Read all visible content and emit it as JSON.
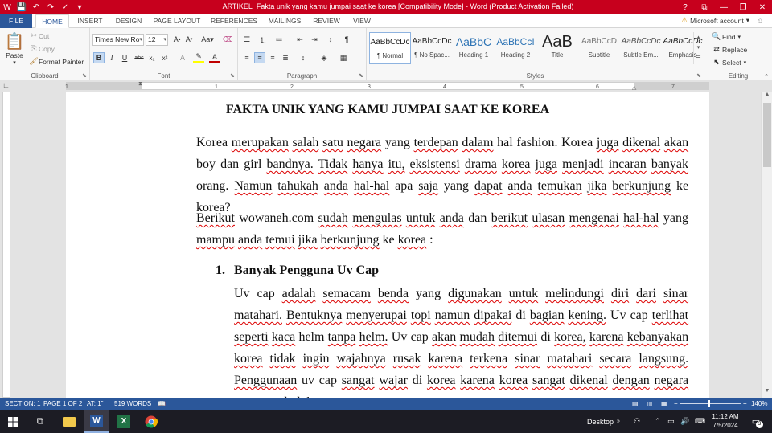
{
  "window": {
    "title": "ARTIKEL_Fakta unik yang kamu jumpai saat ke korea [Compatibility Mode] - Word (Product Activation Failed)",
    "controls": {
      "help": "?",
      "ribbon_opts": "⧉",
      "minimize": "—",
      "restore": "❐",
      "close": "✕"
    }
  },
  "qat": {
    "save_icon": "save-icon",
    "undo_icon": "undo-icon",
    "redo_icon": "redo-icon",
    "spell_icon": "spell-check-icon",
    "customize_icon": "customize-icon"
  },
  "ribbon_tabs": [
    "FILE",
    "HOME",
    "INSERT",
    "DESIGN",
    "PAGE LAYOUT",
    "REFERENCES",
    "MAILINGS",
    "REVIEW",
    "VIEW"
  ],
  "active_tab": "HOME",
  "account": {
    "warning": "⚠",
    "label": "Microsoft account",
    "caret": "▾"
  },
  "clipboard": {
    "paste": "Paste",
    "cut": "Cut",
    "copy": "Copy",
    "format_painter": "Format Painter",
    "group_label": "Clipboard"
  },
  "font": {
    "name": "Times New Ro",
    "size": "12",
    "group_label": "Font"
  },
  "paragraph": {
    "group_label": "Paragraph"
  },
  "styles": {
    "group_label": "Styles",
    "items": [
      {
        "preview": "AaBbCcDc",
        "label": "¶ Normal"
      },
      {
        "preview": "AaBbCcDc",
        "label": "¶ No Spac..."
      },
      {
        "preview": "AaBbC",
        "label": "Heading 1"
      },
      {
        "preview": "AaBbCcI",
        "label": "Heading 2"
      },
      {
        "preview": "AaB",
        "label": "Title"
      },
      {
        "preview": "AaBbCcD",
        "label": "Subtitle"
      },
      {
        "preview": "AaBbCcDc",
        "label": "Subtle Em..."
      },
      {
        "preview": "AaBbCcDc",
        "label": "Emphasis"
      }
    ]
  },
  "editing": {
    "find": "Find",
    "replace": "Replace",
    "select": "Select",
    "group_label": "Editing"
  },
  "ruler_numbers": [
    "1",
    "1",
    "2",
    "3",
    "4",
    "5",
    "6",
    "7"
  ],
  "document": {
    "title": "FAKTA UNIK YANG KAMU JUMPAI SAAT KE KOREA",
    "para1": "Korea merupakan salah satu negara yang terdepan dalam hal fashion. Korea juga dikenal akan boy dan girl bandnya. Tidak hanya itu, eksistensi drama korea juga menjadi incaran banyak orang. Namun tahukah anda hal-hal apa saja yang dapat anda temukan jika berkunjung ke korea?",
    "para2": "Berikut wowaneh.com sudah mengulas untuk anda dan berikut ulasan mengenai hal-hal yang mampu anda temui jika berkunjung ke korea :",
    "list_num": "1.",
    "list_head": "Banyak Pengguna Uv Cap",
    "para3": "Uv cap adalah semacam benda yang digunakan untuk melindungi diri dari sinar matahari. Bentuknya menyerupai topi namun dipakai di bagian kening. Uv cap terlihat seperti kaca helm tanpa helm. Uv cap akan mudah ditemui di korea, karena kebanyakan korea tidak ingin wajahnya rusak karena terkena sinar matahari secara langsung. Penggunaan uv cap sangat wajar di korea karena korea sangat dikenal dengan negara yang penduduknya"
  },
  "status": {
    "section": "SECTION: 1",
    "page": "PAGE 1 OF 2",
    "at": "AT: 1\"",
    "words": "519 WORDS",
    "zoom": "140%",
    "zoom_minus": "−",
    "zoom_plus": "+",
    "zoom_level": 0.46
  },
  "taskbar": {
    "desktop": "Desktop",
    "time": "11:12 AM",
    "date": "7/5/2024",
    "notif_count": "3"
  }
}
